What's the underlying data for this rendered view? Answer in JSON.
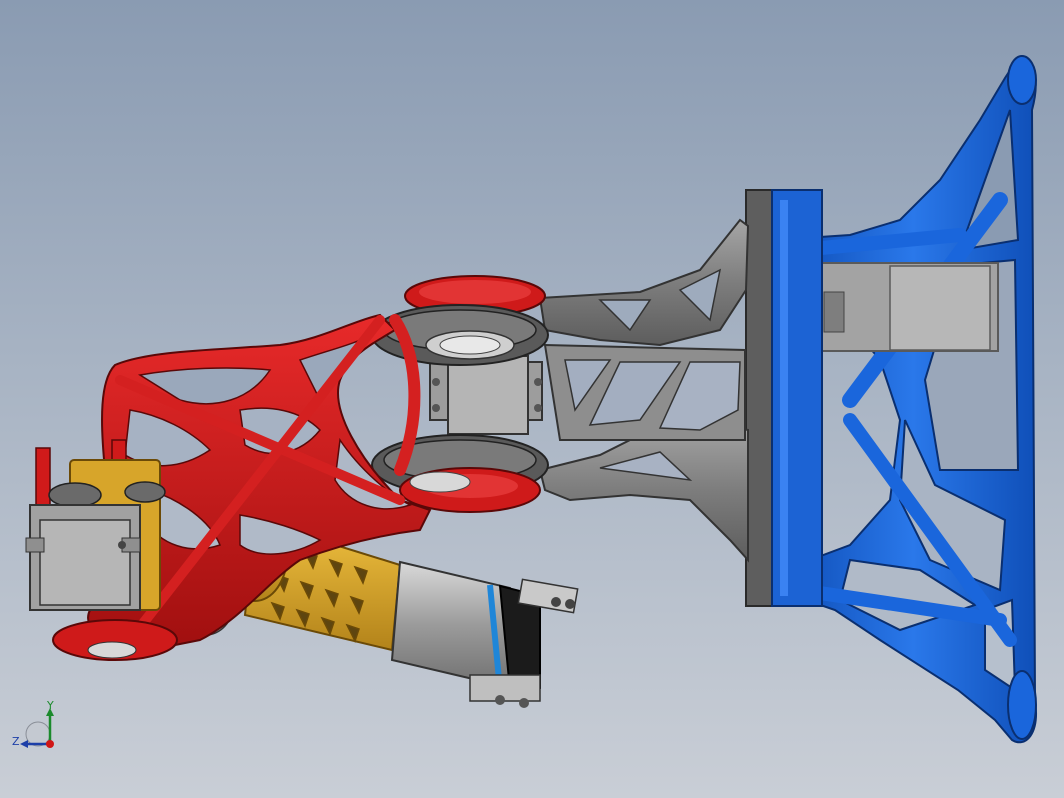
{
  "viewport": {
    "background_top": "#8a9bb2",
    "background_bottom": "#c9ced6"
  },
  "model": {
    "colors": {
      "blue_bracket": "#1560d6",
      "blue_dark": "#0b3b8f",
      "gray_link": "#8c8c8c",
      "gray_dark": "#4d4d4d",
      "red_arm": "#d01616",
      "red_dark": "#7a0a0a",
      "gold_lattice": "#d9a826",
      "motor_silver": "#b5b5b5",
      "motor_black": "#1a1a1a",
      "motor_ring": "#1f86d8"
    },
    "icons": [
      "servo-icon",
      "bearing-icon",
      "motor-icon"
    ]
  },
  "triad": {
    "y_label": "Y",
    "z_label": "Z",
    "y_color": "#1b8a2c",
    "z_color": "#1d3fa8",
    "x_color": "#d01616"
  }
}
